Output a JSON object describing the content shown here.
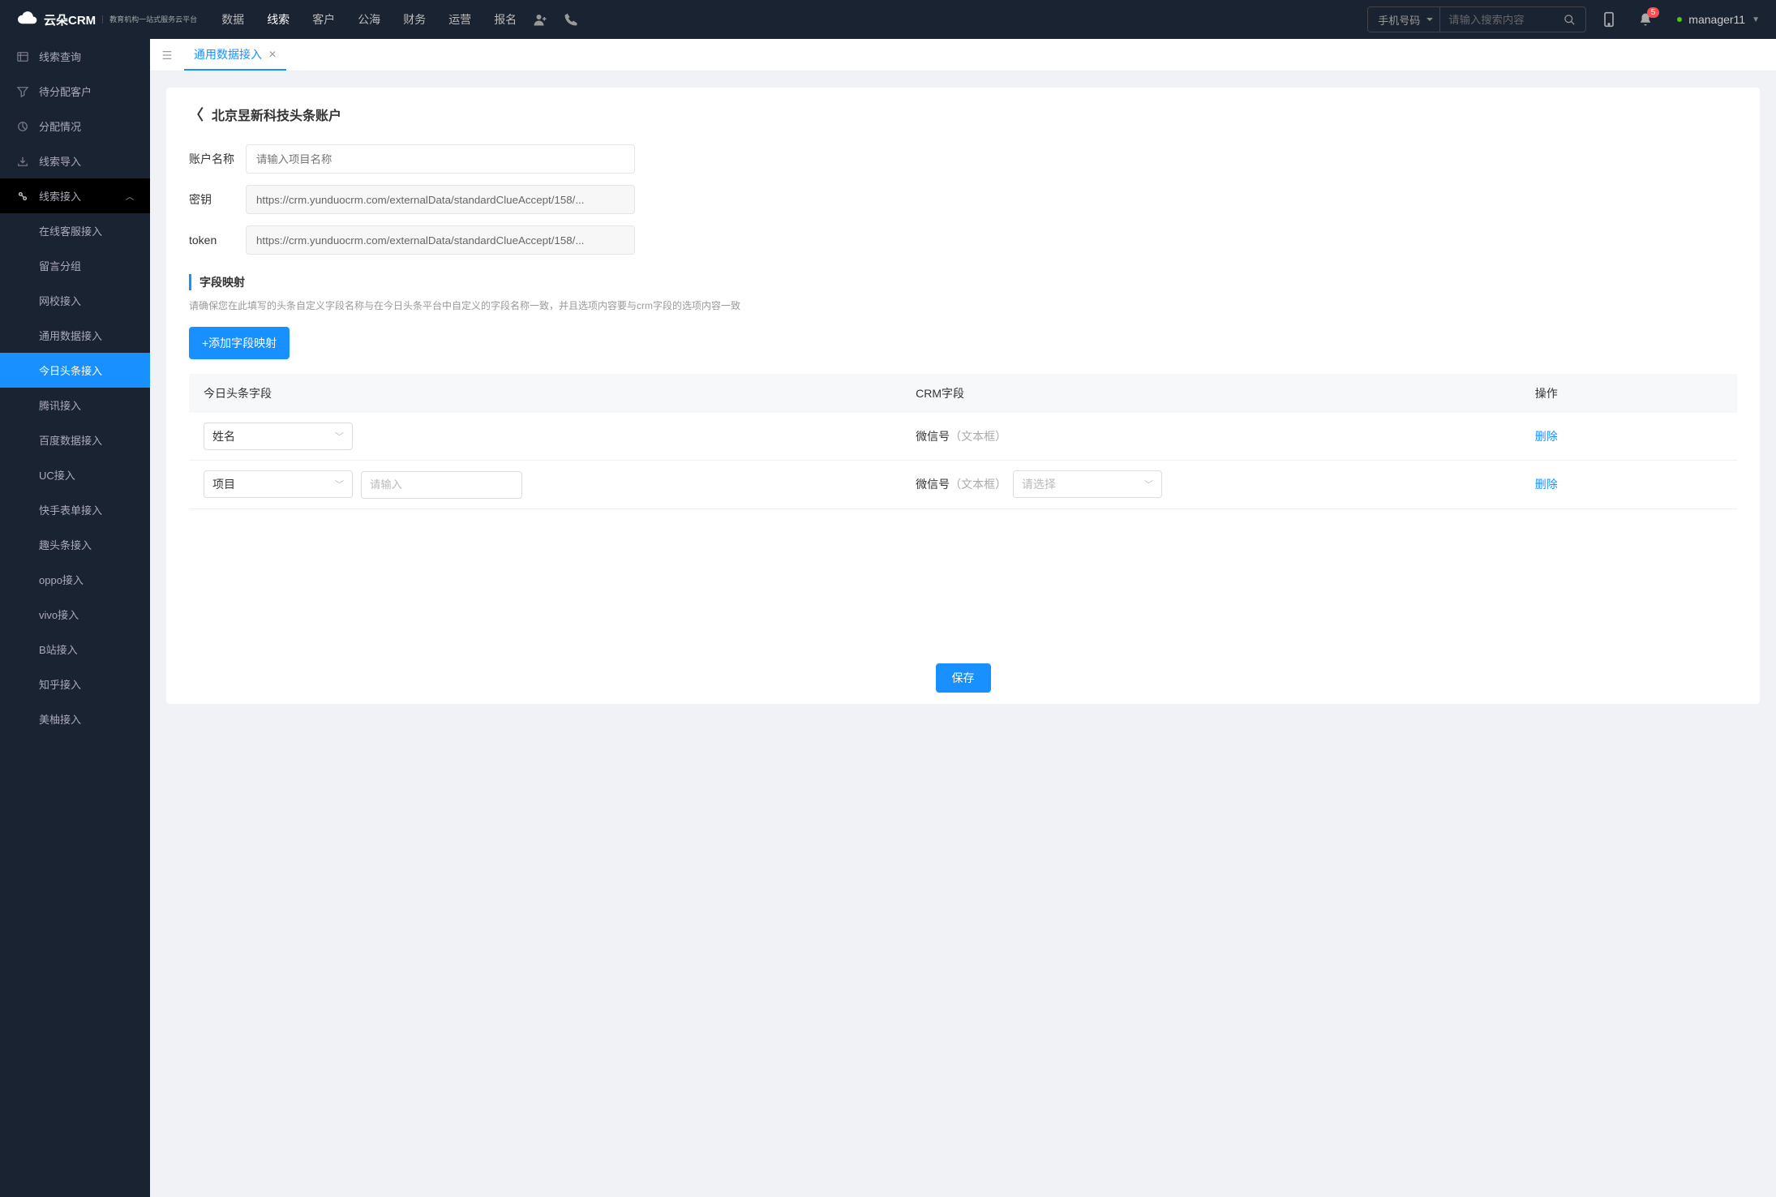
{
  "header": {
    "logo_text": "云朵CRM",
    "logo_sub": "教育机构一站式服务云平台",
    "nav": [
      "数据",
      "线索",
      "客户",
      "公海",
      "财务",
      "运营",
      "报名"
    ],
    "nav_active": 1,
    "search_type": "手机号码",
    "search_placeholder": "请输入搜索内容",
    "badge": "5",
    "username": "manager11"
  },
  "sidebar": {
    "top": [
      {
        "icon": "list",
        "label": "线索查询"
      },
      {
        "icon": "filter",
        "label": "待分配客户"
      },
      {
        "icon": "pie",
        "label": "分配情况"
      },
      {
        "icon": "import",
        "label": "线索导入"
      }
    ],
    "access": {
      "icon": "plug",
      "label": "线索接入",
      "children": [
        "在线客服接入",
        "留言分组",
        "网校接入",
        "通用数据接入",
        "今日头条接入",
        "腾讯接入",
        "百度数据接入",
        "UC接入",
        "快手表单接入",
        "趣头条接入",
        "oppo接入",
        "vivo接入",
        "B站接入",
        "知乎接入",
        "美柚接入"
      ],
      "active": 4
    }
  },
  "tabs": {
    "active": "通用数据接入"
  },
  "page": {
    "title": "北京昱新科技头条账户",
    "form": {
      "account_label": "账户名称",
      "account_placeholder": "请输入项目名称",
      "secret_label": "密钥",
      "secret_value": "https://crm.yunduocrm.com/externalData/standardClueAccept/158/...",
      "token_label": "token",
      "token_value": "https://crm.yunduocrm.com/externalData/standardClueAccept/158/..."
    },
    "mapping": {
      "header": "字段映射",
      "hint": "请确保您在此填写的头条自定义字段名称与在今日头条平台中自定义的字段名称一致，并且选项内容要与crm字段的选项内容一致",
      "add_btn": "+添加字段映射",
      "cols": {
        "toutiao": "今日头条字段",
        "crm": "CRM字段",
        "op": "操作"
      },
      "rows": [
        {
          "toutiao_sel": "姓名",
          "extra_input": false,
          "crm_label": "微信号",
          "crm_type": "（文本框）",
          "crm_sel": null
        },
        {
          "toutiao_sel": "项目",
          "extra_input": true,
          "extra_ph": "请输入",
          "crm_label": "微信号",
          "crm_type": "（文本框）",
          "crm_sel": "",
          "crm_sel_ph": "请选择"
        }
      ],
      "del_label": "删除"
    },
    "save": "保存"
  }
}
